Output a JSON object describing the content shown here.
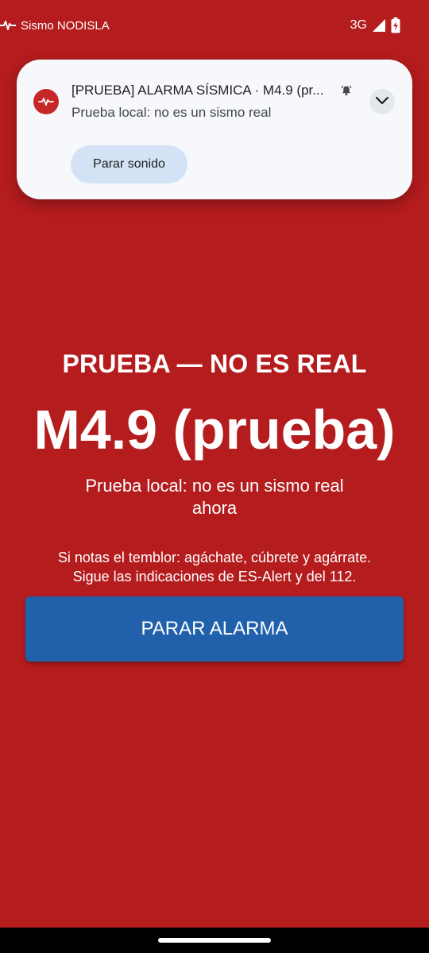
{
  "status_bar": {
    "app_name": "Sismo NODISLA",
    "network": "3G",
    "icons": [
      "seismic-pulse-icon",
      "signal-icon",
      "battery-charging-icon"
    ]
  },
  "notification": {
    "title": "[PRUEBA] ALARMA SÍSMICA · M4.9 (pr...",
    "text": "Prueba local: no es un sismo real",
    "action_label": "Parar sonido",
    "icons": [
      "seismic-app-icon",
      "alarm-bell-icon",
      "chevron-down-icon"
    ]
  },
  "alarm": {
    "heading": "PRUEBA — NO ES REAL",
    "magnitude": "M4.9 (prueba)",
    "description_line1": "Prueba local: no es un sismo real",
    "description_line2": "ahora",
    "instructions_line1": "Si notas el temblor: agáchate, cúbrete y agárrate.",
    "instructions_line2": "Sigue las indicaciones de ES-Alert y del 112.",
    "stop_button_label": "PARAR ALARMA"
  },
  "colors": {
    "background": "#b41c1e",
    "button": "#2160ab",
    "notification_bg": "#f6f8fc",
    "notification_action_bg": "#d3e3f5",
    "app_icon_bg": "#c62828"
  }
}
